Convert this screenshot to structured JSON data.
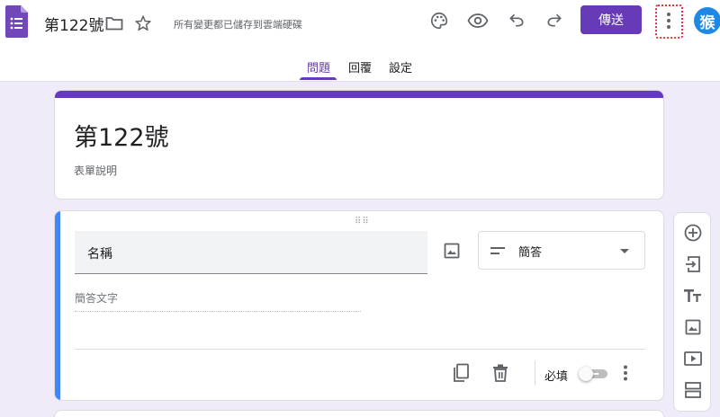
{
  "header": {
    "doc_title": "第122號",
    "save_status": "所有變更都已儲存到雲端硬碟",
    "send_label": "傳送",
    "avatar_initial": "猴",
    "colors": {
      "accent": "#673ab7",
      "avatar": "#1e88e5",
      "highlight": "#e53935"
    }
  },
  "tabs": [
    {
      "label": "問題",
      "active": true
    },
    {
      "label": "回覆",
      "active": false
    },
    {
      "label": "設定",
      "active": false
    }
  ],
  "form": {
    "title": "第122號",
    "description": "表單說明"
  },
  "question": {
    "title": "名稱",
    "type": "簡答",
    "answer_placeholder": "簡答文字",
    "required_label": "必填",
    "required": false
  },
  "side_toolbar": {
    "items": [
      "add-question-icon",
      "import-question-icon",
      "title-text-icon",
      "add-image-icon",
      "add-video-icon",
      "add-section-icon"
    ]
  }
}
